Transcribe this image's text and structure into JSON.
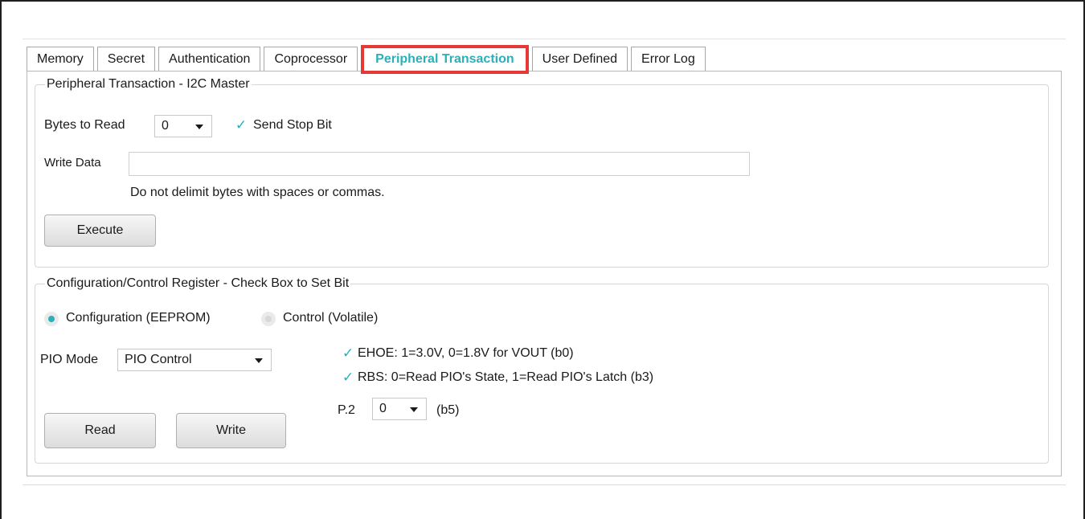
{
  "tabs": [
    {
      "label": "Memory"
    },
    {
      "label": "Secret"
    },
    {
      "label": "Authentication"
    },
    {
      "label": "Coprocessor"
    },
    {
      "label": "Peripheral Transaction"
    },
    {
      "label": "User Defined"
    },
    {
      "label": "Error Log"
    }
  ],
  "selected_tab": "Peripheral Transaction",
  "i2c": {
    "legend": "Peripheral Transaction - I2C Master",
    "bytes_to_read_label": "Bytes to Read",
    "bytes_to_read_value": "0",
    "send_stop_bit_label": "Send Stop Bit",
    "send_stop_bit_checked": true,
    "write_data_label": "Write Data",
    "write_data_value": "",
    "hint": "Do not delimit bytes with spaces or commas.",
    "execute_label": "Execute"
  },
  "config": {
    "legend": "Configuration/Control Register - Check Box to Set Bit",
    "radio_config_label": "Configuration (EEPROM)",
    "radio_control_label": "Control (Volatile)",
    "selected_radio": "Configuration (EEPROM)",
    "pio_mode_label": "PIO Mode",
    "pio_mode_value": "PIO Control",
    "ehoe_label": "EHOE: 1=3.0V, 0=1.8V for VOUT (b0)",
    "ehoe_checked": true,
    "rbs_label": "RBS: 0=Read PIO's State, 1=Read PIO's Latch (b3)",
    "rbs_checked": true,
    "p2_label": "P.2",
    "p2_value": "0",
    "p2_suffix": "(b5)",
    "read_label": "Read",
    "write_label": "Write"
  },
  "colors": {
    "accent": "#2ab0b8",
    "highlight_border": "#e53935"
  },
  "icons": {
    "checkmark": "checkmark-icon",
    "dropdown": "chevron-down-icon"
  }
}
